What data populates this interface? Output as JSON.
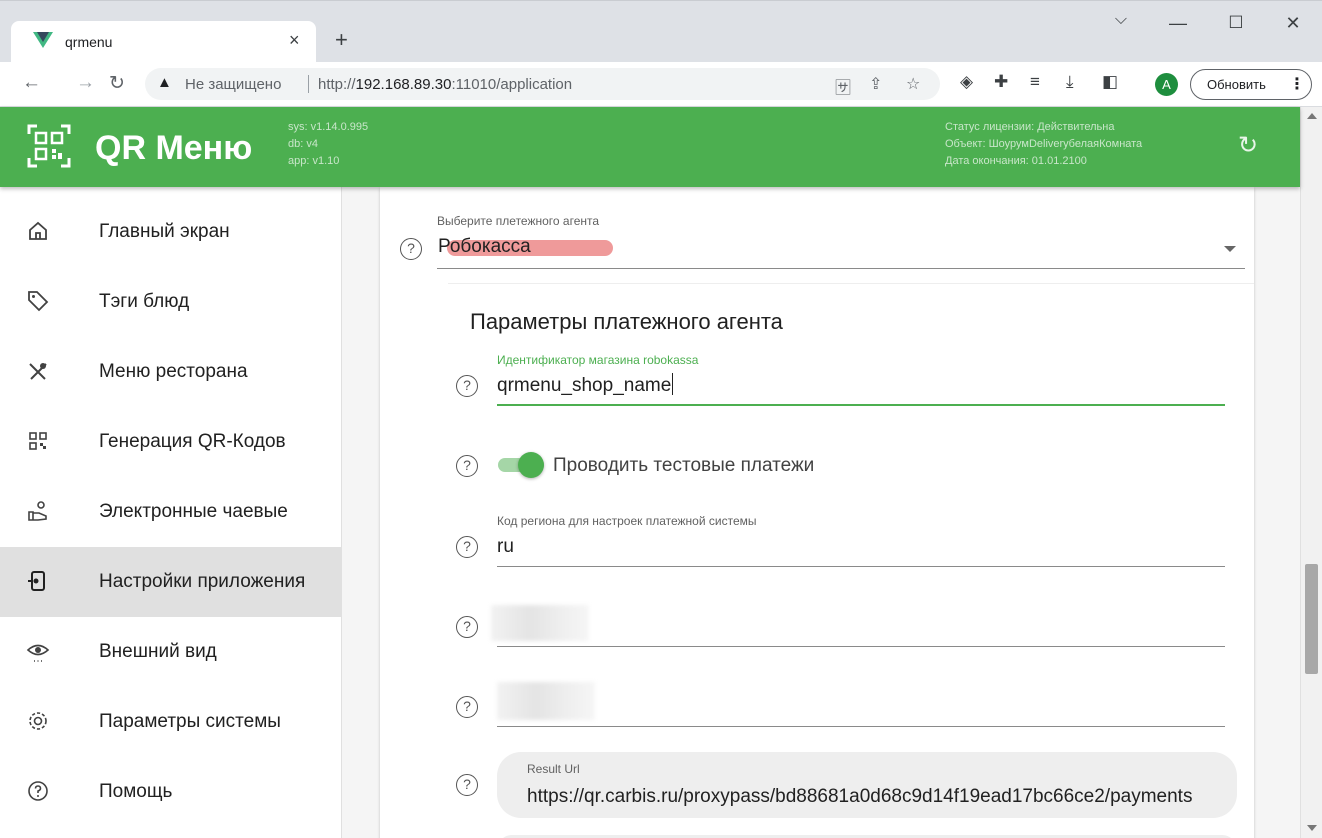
{
  "browser": {
    "tab_title": "qrmenu",
    "tab_close": "×",
    "new_tab": "+",
    "window_controls": {
      "minimize": "—",
      "maximize": "☐",
      "close": "✕",
      "tab_search": "⌵"
    },
    "not_secure": "Не защищено",
    "url_prefix": "http://",
    "url_host": "192.168.89.30",
    "url_rest": ":11010/application",
    "update_label": "Обновить",
    "avatar_letter": "A",
    "icons": [
      "back-icon",
      "forward-icon",
      "reload-icon",
      "warning-icon",
      "translate-icon",
      "share-icon",
      "star-icon",
      "shield-icon",
      "puzzle-icon",
      "reading-list-icon",
      "download-icon",
      "sidepanel-icon"
    ]
  },
  "app": {
    "name": "QR Меню",
    "versions": [
      "sys: v1.14.0.995",
      "db: v4",
      "app: v1.10"
    ],
    "license": [
      "Статус лицензии: Действительна",
      "Объект: ШоурумDeliveryбелаяКомната",
      "Дата окончания: 01.01.2100"
    ],
    "brand_color": "#4caf50"
  },
  "sidebar": {
    "items": [
      {
        "label": "Главный экран",
        "icon": "home-icon"
      },
      {
        "label": "Тэги блюд",
        "icon": "tag-icon"
      },
      {
        "label": "Меню ресторана",
        "icon": "cutlery-icon"
      },
      {
        "label": "Генерация QR-Кодов",
        "icon": "qr-icon"
      },
      {
        "label": "Электронные чаевые",
        "icon": "tips-hand-icon"
      },
      {
        "label": "Настройки приложения",
        "icon": "app-settings-icon",
        "active": true
      },
      {
        "label": "Внешний вид",
        "icon": "eye-icon"
      },
      {
        "label": "Параметры системы",
        "icon": "gear-icon"
      },
      {
        "label": "Помощь",
        "icon": "help-icon"
      }
    ]
  },
  "form": {
    "agent_label": "Выберите плетежного агента",
    "agent_value": "Робокасса",
    "section_title": "Параметры платежного агента",
    "shop_id_label": "Идентификатор магазина robokassa",
    "shop_id_value": "qrmenu_shop_name",
    "test_switch_label": "Проводить тестовые платежи",
    "test_switch_on": true,
    "region_label": "Код региона для настроек платежной системы",
    "region_value": "ru",
    "result_url_label": "Result Url",
    "result_url_value": "https://qr.carbis.ru/proxypass/bd88681a0d68c9d14f19ead17bc66ce2/payments",
    "help_glyph": "?"
  }
}
